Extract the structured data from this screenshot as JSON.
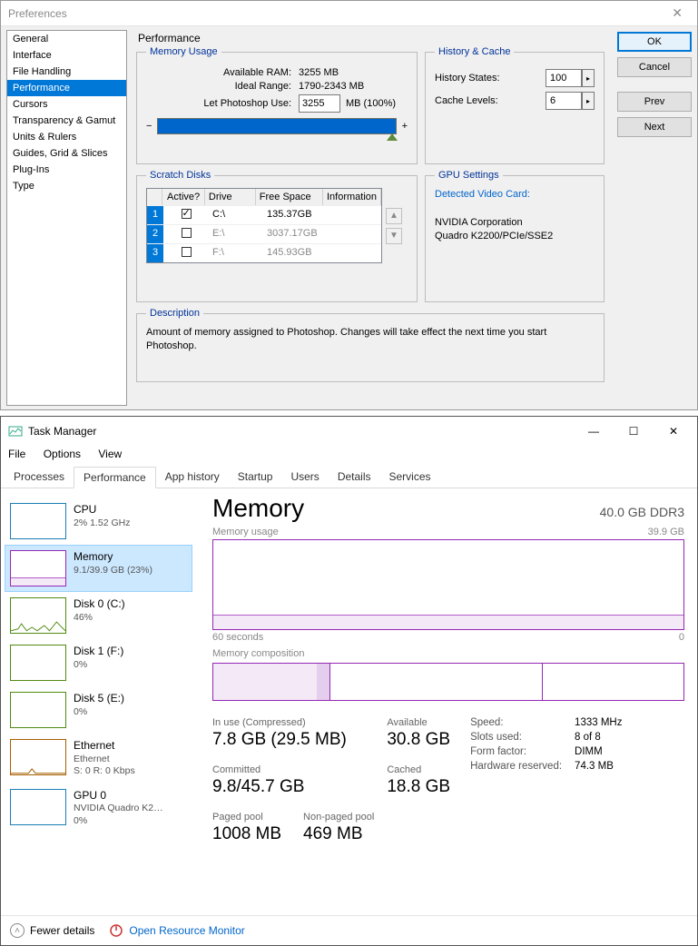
{
  "prefs": {
    "title": "Preferences",
    "sidebar": [
      {
        "label": "General"
      },
      {
        "label": "Interface"
      },
      {
        "label": "File Handling"
      },
      {
        "label": "Performance",
        "selected": true
      },
      {
        "label": "Cursors"
      },
      {
        "label": "Transparency & Gamut"
      },
      {
        "label": "Units & Rulers"
      },
      {
        "label": "Guides, Grid & Slices"
      },
      {
        "label": "Plug-Ins"
      },
      {
        "label": "Type"
      }
    ],
    "buttons": {
      "ok": "OK",
      "cancel": "Cancel",
      "prev": "Prev",
      "next": "Next"
    },
    "panel_title": "Performance",
    "memory": {
      "legend": "Memory Usage",
      "avail_lbl": "Available RAM:",
      "avail_val": "3255 MB",
      "ideal_lbl": "Ideal Range:",
      "ideal_val": "1790-2343 MB",
      "let_lbl": "Let Photoshop Use:",
      "let_val": "3255",
      "let_suffix": "MB (100%)",
      "minus": "−",
      "plus": "+"
    },
    "history": {
      "legend": "History & Cache",
      "states_lbl": "History States:",
      "states_val": "100",
      "cache_lbl": "Cache Levels:",
      "cache_val": "6"
    },
    "scratch": {
      "legend": "Scratch Disks",
      "head_active": "Active?",
      "head_drive": "Drive",
      "head_free": "Free Space",
      "head_info": "Information",
      "rows": [
        {
          "n": "1",
          "active": true,
          "drive": "C:\\",
          "free": "135.37GB"
        },
        {
          "n": "2",
          "active": false,
          "drive": "E:\\",
          "free": "3037.17GB"
        },
        {
          "n": "3",
          "active": false,
          "drive": "F:\\",
          "free": "145.93GB"
        }
      ]
    },
    "gpu": {
      "legend": "GPU Settings",
      "detected_lbl": "Detected Video Card:",
      "vendor": "NVIDIA Corporation",
      "card": "Quadro K2200/PCIe/SSE2"
    },
    "desc": {
      "legend": "Description",
      "text": "Amount of memory assigned to Photoshop. Changes will take effect the next time you start Photoshop."
    }
  },
  "tm": {
    "title": "Task Manager",
    "menu": {
      "file": "File",
      "options": "Options",
      "view": "View"
    },
    "tabs": [
      "Processes",
      "Performance",
      "App history",
      "Startup",
      "Users",
      "Details",
      "Services"
    ],
    "tab_active": 1,
    "left": [
      {
        "kind": "cpu",
        "title": "CPU",
        "sub": "2%  1.52 GHz"
      },
      {
        "kind": "mem",
        "title": "Memory",
        "sub": "9.1/39.9 GB (23%)",
        "selected": true
      },
      {
        "kind": "disk",
        "title": "Disk 0 (C:)",
        "sub": "46%"
      },
      {
        "kind": "disk",
        "title": "Disk 1 (F:)",
        "sub": "0%"
      },
      {
        "kind": "disk",
        "title": "Disk 5 (E:)",
        "sub": "0%"
      },
      {
        "kind": "eth",
        "title": "Ethernet",
        "sub": "Ethernet",
        "sub2": "S: 0  R: 0 Kbps"
      },
      {
        "kind": "gpu",
        "title": "GPU 0",
        "sub": "NVIDIA Quadro K2…",
        "sub2": "0%"
      }
    ],
    "right": {
      "heading": "Memory",
      "total": "40.0 GB DDR3",
      "usage_lbl": "Memory usage",
      "usage_max": "39.9 GB",
      "x_left": "60 seconds",
      "x_right": "0",
      "comp_lbl": "Memory composition",
      "stats": {
        "inuse_lbl": "In use (Compressed)",
        "inuse_val": "7.8 GB (29.5 MB)",
        "avail_lbl": "Available",
        "avail_val": "30.8 GB",
        "comm_lbl": "Committed",
        "comm_val": "9.8/45.7 GB",
        "cached_lbl": "Cached",
        "cached_val": "18.8 GB",
        "paged_lbl": "Paged pool",
        "paged_val": "1008 MB",
        "npaged_lbl": "Non-paged pool",
        "npaged_val": "469 MB"
      },
      "spec": {
        "speed_lbl": "Speed:",
        "speed_val": "1333 MHz",
        "slots_lbl": "Slots used:",
        "slots_val": "8 of 8",
        "ff_lbl": "Form factor:",
        "ff_val": "DIMM",
        "hr_lbl": "Hardware reserved:",
        "hr_val": "74.3 MB"
      }
    },
    "footer": {
      "fewer": "Fewer details",
      "orm": "Open Resource Monitor"
    }
  },
  "chart_data": {
    "type": "line",
    "title": "Memory usage",
    "ylabel": "GB",
    "ylim": [
      0,
      39.9
    ],
    "xlabel": "seconds",
    "xlim": [
      60,
      0
    ],
    "series": [
      {
        "name": "Memory",
        "values": [
          7.6,
          7.6,
          7.6,
          7.6,
          7.6,
          7.6,
          7.6,
          7.6,
          7.7,
          7.8
        ]
      }
    ]
  }
}
